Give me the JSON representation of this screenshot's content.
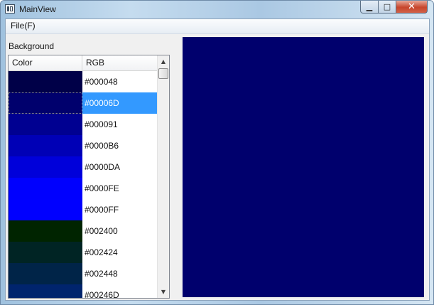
{
  "window": {
    "title": "MainView"
  },
  "controls": {
    "minimize_glyph": "▁",
    "maximize_glyph": "□",
    "close_glyph": "✕"
  },
  "menu": {
    "file_label": "File(F)"
  },
  "panel": {
    "background_label": "Background"
  },
  "table": {
    "headers": {
      "color": "Color",
      "rgb": "RGB"
    },
    "rows": [
      {
        "hex": "#000048",
        "color": "#000048"
      },
      {
        "hex": "#00006D",
        "color": "#00006D",
        "selected": true
      },
      {
        "hex": "#000091",
        "color": "#000091"
      },
      {
        "hex": "#0000B6",
        "color": "#0000B6"
      },
      {
        "hex": "#0000DA",
        "color": "#0000DA"
      },
      {
        "hex": "#0000FE",
        "color": "#0000FE"
      },
      {
        "hex": "#0000FF",
        "color": "#0000FF"
      },
      {
        "hex": "#002400",
        "color": "#002400"
      },
      {
        "hex": "#002424",
        "color": "#002424"
      },
      {
        "hex": "#002448",
        "color": "#002448"
      },
      {
        "hex": "#00246D",
        "color": "#00246D"
      }
    ]
  },
  "scrollbar": {
    "up_glyph": "▲",
    "down_glyph": "▼"
  },
  "preview": {
    "color": "#00006D"
  }
}
